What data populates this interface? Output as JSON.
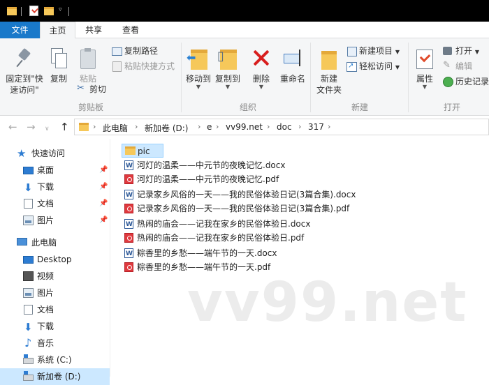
{
  "ribbon_tabs": {
    "file": "文件",
    "home": "主页",
    "share": "共享",
    "view": "查看"
  },
  "clipboard": {
    "pin_label_line1": "固定到\"快",
    "pin_label_line2": "速访问\"",
    "copy": "复制",
    "paste": "粘贴",
    "copy_path": "复制路径",
    "paste_shortcut": "粘贴快捷方式",
    "cut": "剪切",
    "group_label": "剪贴板"
  },
  "organize": {
    "move_to": "移动到",
    "copy_to": "复制到",
    "delete": "删除",
    "rename": "重命名",
    "group_label": "组织"
  },
  "new": {
    "new_folder_line1": "新建",
    "new_folder_line2": "文件夹",
    "new_item": "新建项目",
    "easy_access": "轻松访问",
    "group_label": "新建"
  },
  "open": {
    "properties": "属性",
    "open": "打开",
    "edit": "编辑",
    "history": "历史记录",
    "group_label": "打开"
  },
  "breadcrumb": [
    "此电脑",
    "新加卷 (D:)",
    "e",
    "vv99.net",
    "doc",
    "317"
  ],
  "sidebar": {
    "quick_access": "快速访问",
    "quick_items": [
      "桌面",
      "下载",
      "文档",
      "图片"
    ],
    "this_pc": "此电脑",
    "pc_items": [
      "Desktop",
      "视频",
      "图片",
      "文档",
      "下载",
      "音乐",
      "系统 (C:)",
      "新加卷 (D:)"
    ]
  },
  "files": [
    {
      "name": "pic",
      "type": "folder"
    },
    {
      "name": "河灯的温柔——中元节的夜晚记忆.docx",
      "type": "docx"
    },
    {
      "name": "河灯的温柔——中元节的夜晚记忆.pdf",
      "type": "pdf"
    },
    {
      "name": "记录家乡风俗的一天——我的民俗体验日记(3篇合集).docx",
      "type": "docx"
    },
    {
      "name": "记录家乡风俗的一天——我的民俗体验日记(3篇合集).pdf",
      "type": "pdf"
    },
    {
      "name": "热闹的庙会——记我在家乡的民俗体验日.docx",
      "type": "docx"
    },
    {
      "name": "热闹的庙会——记我在家乡的民俗体验日.pdf",
      "type": "pdf"
    },
    {
      "name": "粽香里的乡愁——端午节的一天.docx",
      "type": "docx"
    },
    {
      "name": "粽香里的乡愁——端午节的一天.pdf",
      "type": "pdf"
    }
  ],
  "watermark": "vv99.net",
  "colors": {
    "accent": "#1979ca",
    "selection": "#cce8ff",
    "folder": "#f6c85a"
  }
}
